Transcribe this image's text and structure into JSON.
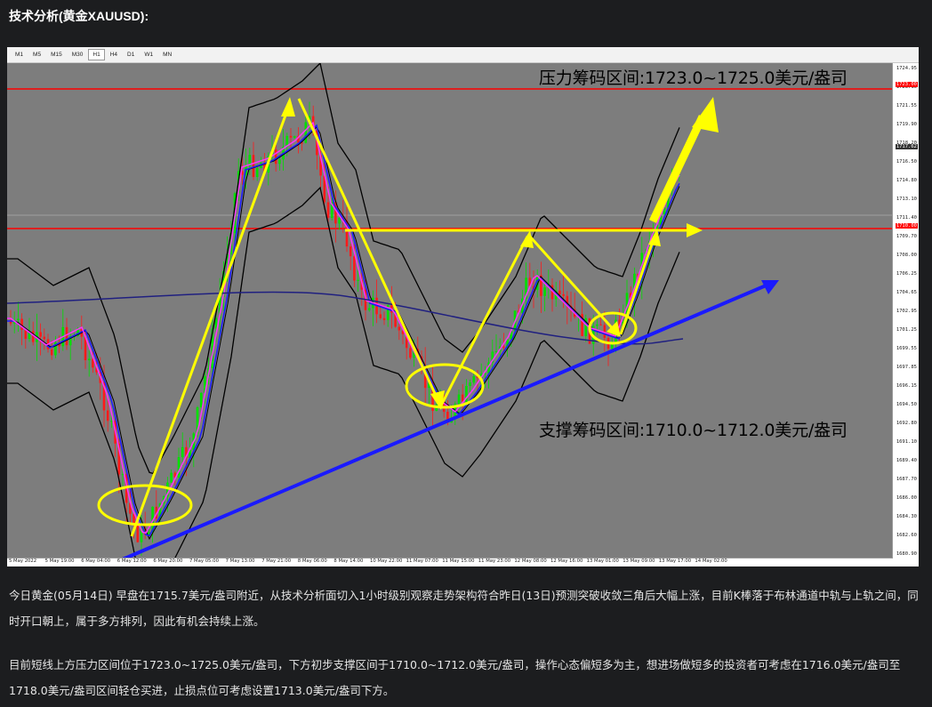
{
  "title": "技术分析(黄金XAUUSD):",
  "toolbar": {
    "timeframes": [
      "M1",
      "M5",
      "M15",
      "M30",
      "H1",
      "H4",
      "D1",
      "W1",
      "MN"
    ],
    "active": "H1"
  },
  "annotations": {
    "resistance": "压力筹码区间:1723.0~1725.0美元/盎司",
    "support": "支撑筹码区间:1710.0~1712.0美元/盎司"
  },
  "price_axis": {
    "ticks": [
      "1724.95",
      "1723.10",
      "1721.55",
      "1719.90",
      "1718.20",
      "1716.50",
      "1714.80",
      "1713.10",
      "1711.40",
      "1709.70",
      "1708.00",
      "1706.25",
      "1704.65",
      "1702.95",
      "1701.25",
      "1699.55",
      "1697.85",
      "1696.15",
      "1694.50",
      "1692.80",
      "1691.10",
      "1689.40",
      "1687.70",
      "1686.00",
      "1684.30",
      "1682.60",
      "1680.90"
    ],
    "tags": {
      "resistance": "1723.00",
      "current": "1717.62",
      "mid": "1710.00"
    }
  },
  "time_axis": {
    "ticks": [
      "5 May 2022",
      "5 May 19:00",
      "6 May 04:00",
      "6 May 12:00",
      "6 May 20:00",
      "7 May 05:00",
      "7 May 13:00",
      "7 May 21:00",
      "8 May 06:00",
      "8 May 14:00",
      "10 May 22:00",
      "11 May 07:00",
      "11 May 15:00",
      "11 May 23:00",
      "12 May 08:00",
      "12 May 16:00",
      "13 May 01:00",
      "13 May 09:00",
      "13 May 17:00",
      "14 May 02:00"
    ]
  },
  "colors": {
    "plot_bg": "#7d7d7d",
    "bull": "#00e000",
    "bear": "#ff1a1a",
    "resistance_line": "#ff0000",
    "trend_line": "#1a1aff",
    "annotation": "#ffff00"
  },
  "paragraphs": {
    "p1": "今日黄金(05月14日) 早盘在1715.7美元/盎司附近，从技术分析面切入1小时级别观察走势架构符合昨日(13日)预测突破收敛三角后大幅上涨，目前K棒落于布林通道中轨与上轨之间，同时开口朝上，属于多方排列，因此有机会持续上涨。",
    "p2": "目前短线上方压力区间位于1723.0~1725.0美元/盎司，下方初步支撑区间于1710.0~1712.0美元/盎司，操作心态偏短多为主，想进场做短多的投资者可考虑在1716.0美元/盎司至1718.0美元/盎司区间轻仓买进，止损点位可考虑设置1713.0美元/盎司下方。"
  }
}
